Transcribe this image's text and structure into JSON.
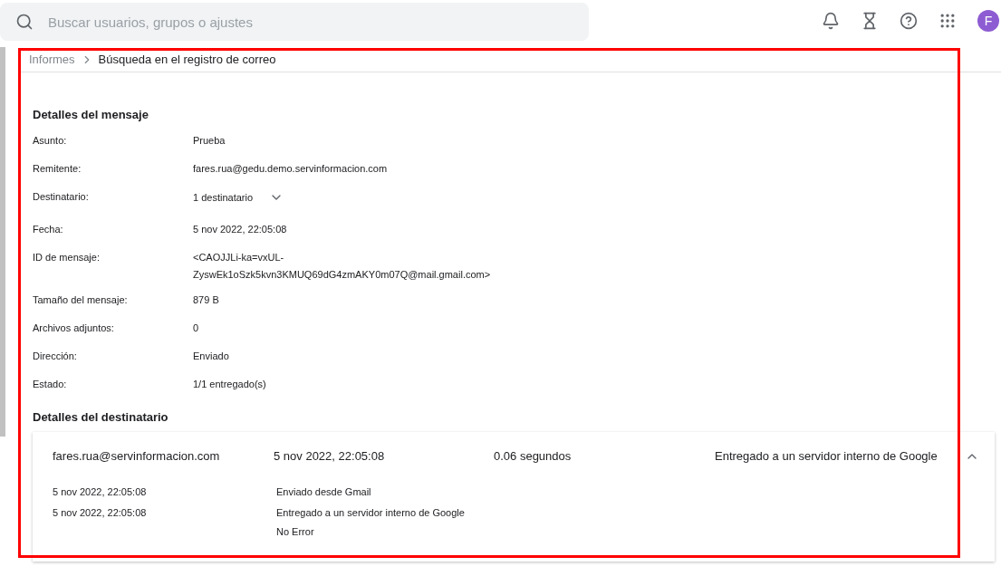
{
  "search": {
    "placeholder": "Buscar usuarios, grupos o ajustes"
  },
  "avatar": {
    "letter": "F"
  },
  "breadcrumb": [
    {
      "label": "Informes",
      "selected": false
    },
    {
      "label": "Búsqueda en el registro de correo",
      "selected": true
    }
  ],
  "message_details": {
    "title": "Detalles del mensaje",
    "fields": [
      {
        "label": "Asunto:",
        "value": "Prueba"
      },
      {
        "label": "Remitente:",
        "value": "fares.rua@gedu.demo.servinformacion.com"
      },
      {
        "label": "Destinatario:",
        "value": "1 destinatario",
        "kind": "dropdown",
        "expanded": false
      },
      {
        "label": "Fecha:",
        "value": "5 nov 2022, 22:05:08"
      },
      {
        "label": "ID de mensaje:",
        "value": "<CAOJJLi-ka=vxUL-",
        "value_2": "ZyswEk1oSzk5kvn3KMUQ69dG4zmAKY0m07Q@mail.gmail.com>"
      },
      {
        "label": "Tamaño del mensaje:",
        "value": "879 B"
      },
      {
        "label": "Archivos adjuntos:",
        "value": "0"
      },
      {
        "label": "Dirección:",
        "value": "Enviado"
      },
      {
        "label": "Estado:",
        "value": "1/1 entregado(s)"
      }
    ]
  },
  "recipient_details": {
    "title": "Detalles del destinatario",
    "recipients": [
      {
        "address": "fares.rua@servinformacion.com",
        "date": "5 nov 2022, 22:05:08",
        "duration": "0.06 segundos",
        "status": "Entregado a un servidor interno de Google",
        "expanded": true,
        "events": [
          {
            "time": "5 nov 2022, 22:05:08",
            "lines": [
              "Enviado desde Gmail"
            ]
          },
          {
            "time": "5 nov 2022, 22:05:08",
            "lines": [
              "Entregado a un servidor interno de Google",
              "No Error"
            ]
          }
        ]
      }
    ]
  }
}
